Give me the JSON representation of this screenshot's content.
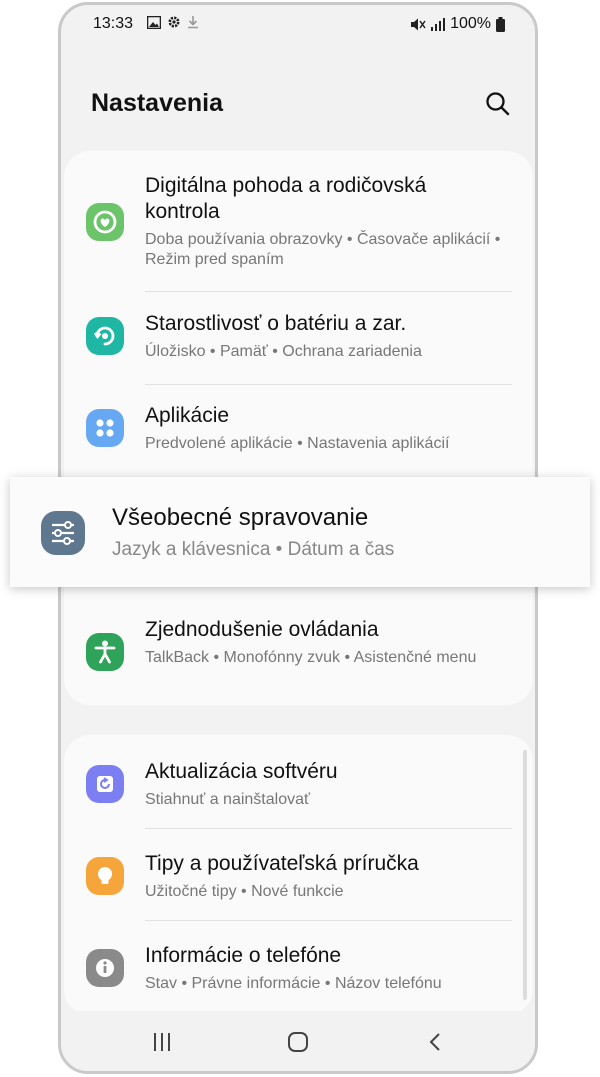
{
  "status_bar": {
    "time": "13:33",
    "battery": "100%"
  },
  "header": {
    "title": "Nastavenia"
  },
  "settings_group_1": [
    {
      "title": "Digitálna pohoda a rodičovská kontrola",
      "subtitle": "Doba používania obrazovky  •  Časovače aplikácií  •  Režim pred spaním",
      "icon": "digital-wellbeing-icon",
      "color": "#6cc46a"
    },
    {
      "title": "Starostlivosť o batériu a zar.",
      "subtitle": "Úložisko  •  Pamäť  •  Ochrana zariadenia",
      "icon": "device-care-icon",
      "color": "#1fb7a3"
    },
    {
      "title": "Aplikácie",
      "subtitle": "Predvolené aplikácie  •  Nastavenia aplikácií",
      "icon": "apps-icon",
      "color": "#66a9f2"
    },
    {
      "title": "Zjednodušenie ovládania",
      "subtitle": "TalkBack  •  Monofónny zvuk  •  Asistenčné menu",
      "icon": "accessibility-icon",
      "color": "#2fa35a"
    }
  ],
  "highlighted_item": {
    "title": "Všeobecné spravovanie",
    "subtitle": "Jazyk a klávesnica  •  Dátum a čas",
    "icon": "general-management-icon",
    "color": "#5f7890"
  },
  "settings_group_2": [
    {
      "title": "Aktualizácia softvéru",
      "subtitle": "Stiahnuť a nainštalovať",
      "icon": "software-update-icon",
      "color": "#7b7ff2"
    },
    {
      "title": "Tipy a používateľská príručka",
      "subtitle": "Užitočné tipy  •  Nové funkcie",
      "icon": "tips-icon",
      "color": "#f6a53a"
    },
    {
      "title": "Informácie o telefóne",
      "subtitle": "Stav  •  Právne informácie  •  Názov telefónu",
      "icon": "info-icon",
      "color": "#8a8a8a"
    }
  ]
}
